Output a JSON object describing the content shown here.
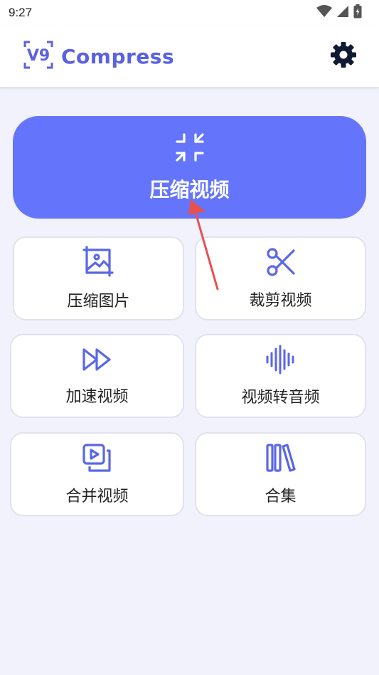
{
  "status_bar": {
    "time": "9:27",
    "icons": [
      "wifi-icon",
      "signal-icon",
      "battery-icon"
    ]
  },
  "app_bar": {
    "logo_mark": "V9",
    "title": "Compress",
    "settings_icon": "gear-icon"
  },
  "colors": {
    "accent": "#6575fb",
    "brand": "#5a62e0",
    "background": "#f1f2fb",
    "annotation_arrow": "#e8504f"
  },
  "hero": {
    "label": "压缩视频",
    "icon": "compress-icon"
  },
  "tools": [
    {
      "label": "压缩图片",
      "icon": "image-crop-icon"
    },
    {
      "label": "裁剪视频",
      "icon": "scissors-icon"
    },
    {
      "label": "加速视频",
      "icon": "fast-forward-icon"
    },
    {
      "label": "视频转音频",
      "icon": "audio-waveform-icon"
    },
    {
      "label": "合并视频",
      "icon": "merge-video-icon"
    },
    {
      "label": "合集",
      "icon": "library-icon"
    }
  ]
}
